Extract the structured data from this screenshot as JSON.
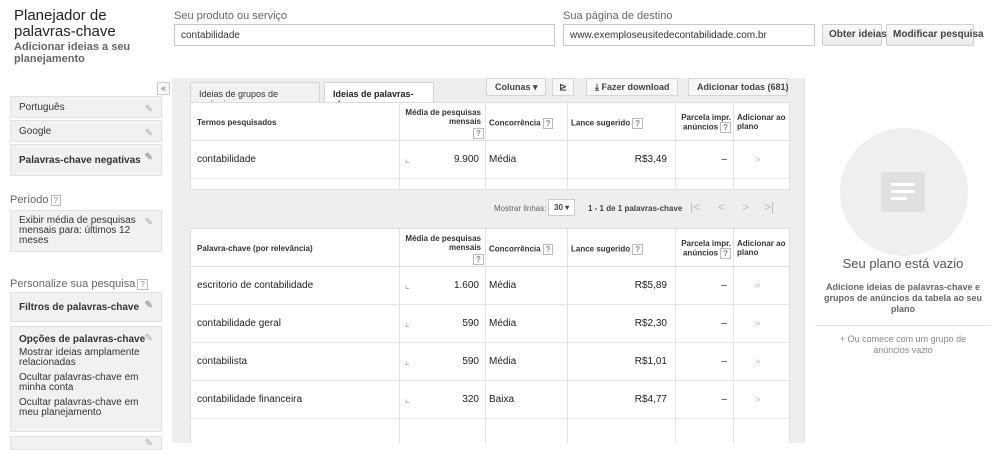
{
  "header": {
    "title": "Planejador de palavras-chave",
    "subtitle": "Adicionar ideias a seu planejamento",
    "product_label": "Seu produto ou serviço",
    "product_value": "contabilidade",
    "dest_label": "Sua página de destino",
    "dest_value": "www.exemploseusitedecontabilidade.com.br",
    "get_ideas": "Obter ideias",
    "modify": "Modificar pesquisa"
  },
  "sidebar": {
    "collapse": "«",
    "language": "Português",
    "network": "Google",
    "negative": "Palavras-chave negativas",
    "period_label": "Período",
    "period_text": "Exibir média de pesquisas mensais para: últimos 12 meses",
    "personalize_label": "Personalize sua pesquisa",
    "filters": "Filtros de palavras-chave",
    "options_title": "Opções de palavras-chave",
    "options_1": "Mostrar ideias amplamente relacionadas",
    "options_2": "Ocultar palavras-chave em minha conta",
    "options_3": "Ocultar palavras-chave em meu planejamento",
    "help": "?"
  },
  "tabs": {
    "groups": "Ideias de grupos de anúncios",
    "keywords": "Ideias de palavras-chave"
  },
  "toolbar": {
    "columns": "Colunas ▾",
    "download": "Fazer download",
    "add_all": "Adicionar todas (681)"
  },
  "table1": {
    "headers": {
      "term": "Termos pesquisados",
      "avg": "Média de pesquisas mensais",
      "comp": "Concorrência",
      "bid": "Lance sugerido",
      "share": "Parcela impr. anúncios",
      "add": "Adicionar ao plano"
    },
    "rows": [
      {
        "kw": "contabilidade",
        "avg": "9.900",
        "comp": "Média",
        "bid": "R$3,49",
        "share": "–",
        "add": "»"
      }
    ]
  },
  "pager": {
    "label": "Mostrar linhas:",
    "value": "30 ▾",
    "range": "1 - 1 de 1 palavras-chave",
    "first": "|<",
    "prev": "<",
    "next": ">",
    "last": ">|"
  },
  "table2": {
    "headers": {
      "term": "Palavra-chave (por relevância)",
      "avg": "Média de pesquisas mensais",
      "comp": "Concorrência",
      "bid": "Lance sugerido",
      "share": "Parcela impr. anúncios",
      "add": "Adicionar ao plano"
    },
    "rows": [
      {
        "kw": "escritorio de contabilidade",
        "avg": "1.600",
        "comp": "Média",
        "bid": "R$5,89",
        "share": "–",
        "add": "»"
      },
      {
        "kw": "contabilidade geral",
        "avg": "590",
        "comp": "Média",
        "bid": "R$2,30",
        "share": "–",
        "add": "»"
      },
      {
        "kw": "contabilista",
        "avg": "590",
        "comp": "Média",
        "bid": "R$1,01",
        "share": "–",
        "add": "»"
      },
      {
        "kw": "contabilidade financeira",
        "avg": "320",
        "comp": "Baixa",
        "bid": "R$4,77",
        "share": "–",
        "add": "»"
      }
    ]
  },
  "plan": {
    "empty": "Seu plano está vazio",
    "hint": "Adicione ideias de palavras-chave e grupos de anúncios da tabela ao seu plano",
    "start": "+ Ou comece com um grupo de anúncios vazio"
  }
}
